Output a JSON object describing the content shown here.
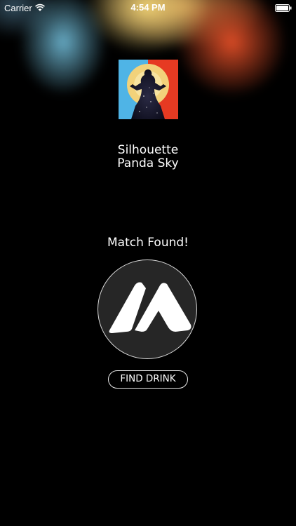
{
  "status_bar": {
    "carrier": "Carrier",
    "time": "4:54 PM",
    "wifi_icon": "wifi-icon",
    "battery_icon": "battery-icon"
  },
  "now_playing": {
    "track_title": "Silhouette",
    "artist": "Panda Sky",
    "album_art_icon": "album-art"
  },
  "match": {
    "status_text": "Match Found!",
    "logo_icon": "mountain-logo-icon"
  },
  "actions": {
    "find_drink_label": "FIND DRINK"
  },
  "colors": {
    "background": "#000000",
    "text": "#ffffff",
    "logo_circle": "#262626",
    "accent_warm": "#e65028",
    "accent_cool": "#78c8e6",
    "accent_yellow": "#f5d778"
  }
}
